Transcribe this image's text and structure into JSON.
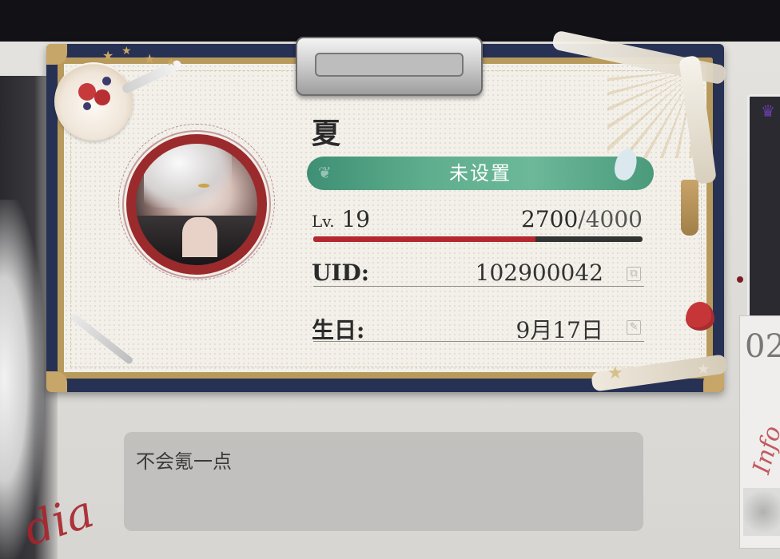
{
  "profile": {
    "name": "夏",
    "title": "未设置",
    "level_prefix": "Lv.",
    "level": "19",
    "exp_current": "2700",
    "exp_separator": "/",
    "exp_max": "4000",
    "exp_progress": 0.675,
    "uid_label": "UID:",
    "uid_value": "102900042",
    "birthday_label": "生日:",
    "birthday_value": "9月17日",
    "bio": "不会氪一点"
  },
  "icons": {
    "copy": "copy-icon",
    "edit": "edit-icon",
    "crown": "crown-icon"
  },
  "colors": {
    "title_pill": "#5fae8e",
    "exp_fill": "#b3282e",
    "board": "#273154",
    "gold": "#b89b5c"
  }
}
